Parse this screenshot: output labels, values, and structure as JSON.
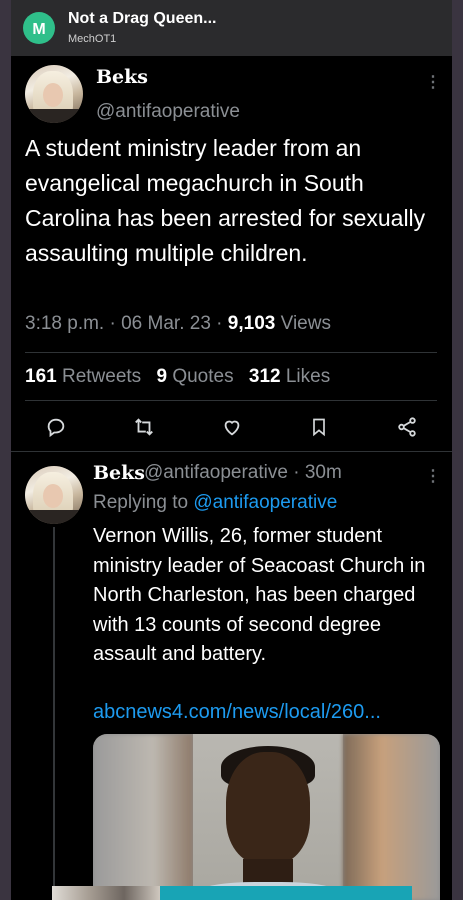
{
  "header": {
    "title": "Not a Drag Queen...",
    "subtitle": "MechOT1",
    "app_icon_letter": "M",
    "accent": "#2fbf8a"
  },
  "tweet": {
    "display_name": "Beks",
    "handle": "@antifaoperative",
    "text": "A student ministry leader from an evangelical  megachurch in South Carolina has been arrested for sexually assaulting multiple children.",
    "time": "3:18 p.m.",
    "date": "06 Mar. 23",
    "views_count": "9,103",
    "views_label": "Views",
    "retweets_count": "161",
    "retweets_label": "Retweets",
    "quotes_count": "9",
    "quotes_label": "Quotes",
    "likes_count": "312",
    "likes_label": "Likes",
    "actions": [
      "reply-icon",
      "retweet-icon",
      "like-icon",
      "bookmark-icon",
      "share-icon"
    ]
  },
  "reply": {
    "display_name": "Beks",
    "handle": "@antifaoperative",
    "age": "30m",
    "replying_prefix": "Replying to",
    "replying_to": "@antifaoperative",
    "text": "Vernon Willis, 26, former student ministry leader of Seacoast Church in North Charleston, has been charged with 13 counts of second degree assault and battery.",
    "link": "abcnews4.com/news/local/260..."
  },
  "colors": {
    "background": "#000000",
    "link": "#1d9bf0",
    "muted": "#8b8f94"
  }
}
